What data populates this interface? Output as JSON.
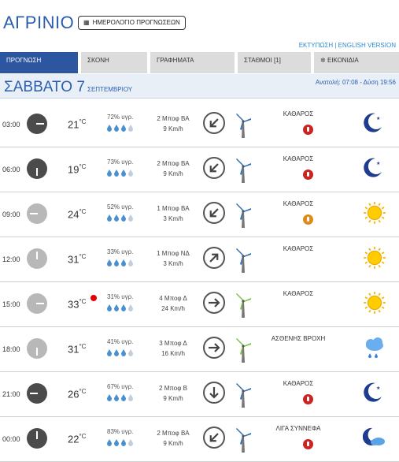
{
  "header": {
    "city": "ΑΓΡΙΝΙΟ",
    "calendar_button": "ΗΜΕΡΟΛΟΓΙΟ ΠΡΟΓΝΩΣΕΩΝ",
    "print_link": "ΕΚΤΥΠΩΣΗ",
    "separator": "|",
    "english_link": "ENGLISH VERSION"
  },
  "tabs": [
    {
      "label": "ΠΡΟΓΝΩΣΗ"
    },
    {
      "label": "ΣΚΟΝΗ"
    },
    {
      "label": "ΓΡΑΦΗΜΑΤΑ"
    },
    {
      "label": "ΣΤΑΘΜΟΙ [1]"
    },
    {
      "label": "ΕΙΚΟΝΙΔΙΑ"
    }
  ],
  "date_bar": {
    "day": "ΣΑΒΒΑΤΟ 7",
    "month": "ΣΕΠΤΕΜΒΡΙΟΥ",
    "sun_times": "Ανατολή: 07:08 - Δύση 19:56"
  },
  "colors": {
    "accent": "#2c56a0",
    "link": "#2a8bd0",
    "hot": "#e00000"
  },
  "forecast": [
    {
      "time": "03:00",
      "temp": "21",
      "unit": "°C",
      "humidity": "72% υγρ.",
      "drops_filled": 3,
      "wind_bf": "2 Μποφ ΒΑ",
      "wind_kmh": "9 Km/h",
      "arrow": "southwest",
      "condition": "ΚΑΘΑΡΟΣ",
      "uv": "red",
      "icon": "moon-icon",
      "night": true,
      "clock_hour": 3
    },
    {
      "time": "06:00",
      "temp": "19",
      "unit": "°C",
      "humidity": "73% υγρ.",
      "drops_filled": 3,
      "wind_bf": "2 Μποφ ΒΑ",
      "wind_kmh": "9 Km/h",
      "arrow": "southwest",
      "condition": "ΚΑΘΑΡΟΣ",
      "uv": "red",
      "icon": "moon-icon",
      "night": true,
      "clock_hour": 6
    },
    {
      "time": "09:00",
      "temp": "24",
      "unit": "°C",
      "humidity": "52% υγρ.",
      "drops_filled": 3,
      "wind_bf": "1 Μποφ ΒΑ",
      "wind_kmh": "3 Km/h",
      "arrow": "southwest",
      "condition": "ΚΑΘΑΡΟΣ",
      "uv": "orange",
      "icon": "sun-icon",
      "night": false,
      "clock_hour": 9
    },
    {
      "time": "12:00",
      "temp": "31",
      "unit": "°C",
      "humidity": "33% υγρ.",
      "drops_filled": 3,
      "wind_bf": "1 Μποφ ΝΔ",
      "wind_kmh": "3 Km/h",
      "arrow": "northeast",
      "condition": "ΚΑΘΑΡΟΣ",
      "uv": "",
      "icon": "sun-icon",
      "night": false,
      "clock_hour": 12
    },
    {
      "time": "15:00",
      "temp": "33",
      "unit": "°C",
      "humidity": "31% υγρ.",
      "drops_filled": 3,
      "wind_bf": "4 Μποφ Δ",
      "wind_kmh": "24 Km/h",
      "arrow": "east",
      "condition": "ΚΑΘΑΡΟΣ",
      "uv": "",
      "icon": "sun-icon",
      "night": false,
      "clock_hour": 3,
      "hot": true,
      "green_turbine": true
    },
    {
      "time": "18:00",
      "temp": "31",
      "unit": "°C",
      "humidity": "41% υγρ.",
      "drops_filled": 3,
      "wind_bf": "3 Μποφ Δ",
      "wind_kmh": "16 Km/h",
      "arrow": "east",
      "condition": "ΑΣΘΕΝΗΣ ΒΡΟΧΗ",
      "uv": "",
      "icon": "rain-cloud-icon",
      "night": false,
      "clock_hour": 6,
      "green_turbine": true
    },
    {
      "time": "21:00",
      "temp": "26",
      "unit": "°C",
      "humidity": "67% υγρ.",
      "drops_filled": 3,
      "wind_bf": "2 Μποφ Β",
      "wind_kmh": "9 Km/h",
      "arrow": "south",
      "condition": "ΚΑΘΑΡΟΣ",
      "uv": "red",
      "icon": "moon-icon",
      "night": true,
      "clock_hour": 9
    },
    {
      "time": "00:00",
      "temp": "22",
      "unit": "°C",
      "humidity": "83% υγρ.",
      "drops_filled": 3,
      "wind_bf": "2 Μποφ ΒΑ",
      "wind_kmh": "9 Km/h",
      "arrow": "southwest",
      "condition": "ΛΙΓΑ ΣΥΝΝΕΦΑ",
      "uv": "red",
      "icon": "moon-cloud-icon",
      "night": true,
      "clock_hour": 12
    }
  ]
}
